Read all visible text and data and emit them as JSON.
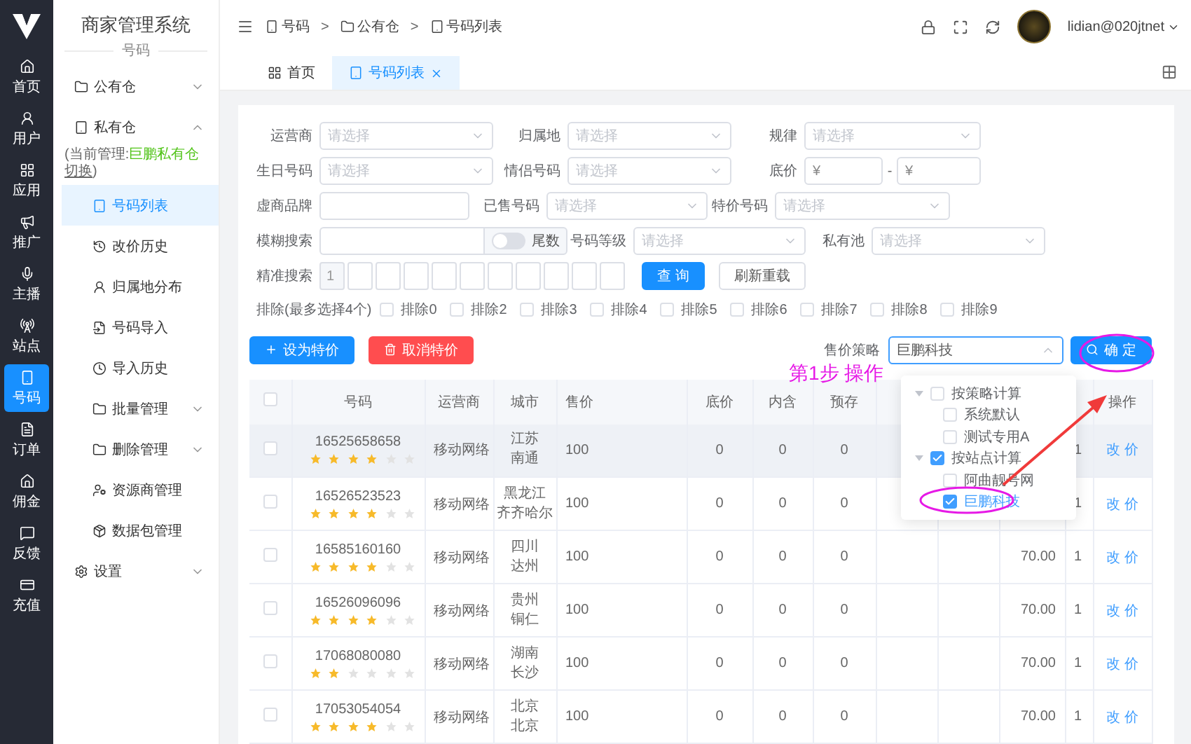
{
  "rail": {
    "items": [
      {
        "label": "首页",
        "selected": false
      },
      {
        "label": "用户",
        "selected": false
      },
      {
        "label": "应用",
        "selected": false
      },
      {
        "label": "推广",
        "selected": false
      },
      {
        "label": "主播",
        "selected": false
      },
      {
        "label": "站点",
        "selected": false
      },
      {
        "label": "号码",
        "selected": true
      },
      {
        "label": "订单",
        "selected": false
      },
      {
        "label": "佣金",
        "selected": false
      },
      {
        "label": "反馈",
        "selected": false
      },
      {
        "label": "充值",
        "selected": false
      }
    ]
  },
  "sidebar": {
    "title": "商家管理系统",
    "subtitle": "号码",
    "items": [
      {
        "label": "公有仓",
        "expanded": false
      },
      {
        "label": "私有仓",
        "expanded": true,
        "note": {
          "prefix": "(当前管理:",
          "highlight": "巨鹏私有仓",
          "link": "切换",
          "suffix": ")"
        },
        "children": [
          {
            "label": "号码列表",
            "kind": "link",
            "selected": true
          },
          {
            "label": "改价历史",
            "kind": "link",
            "selected": false
          },
          {
            "label": "归属地分布",
            "kind": "link",
            "selected": false
          },
          {
            "label": "号码导入",
            "kind": "link",
            "selected": false
          },
          {
            "label": "导入历史",
            "kind": "link",
            "selected": false
          },
          {
            "label": "批量管理",
            "kind": "group",
            "selected": false,
            "expanded": false
          },
          {
            "label": "删除管理",
            "kind": "group",
            "selected": false,
            "expanded": false
          },
          {
            "label": "资源商管理",
            "kind": "link",
            "selected": false
          },
          {
            "label": "数据包管理",
            "kind": "link",
            "selected": false
          }
        ]
      },
      {
        "label": "设置",
        "expanded": false
      }
    ]
  },
  "header": {
    "breadcrumb": [
      {
        "label": "号码",
        "separator": ">"
      },
      {
        "label": "公有仓",
        "separator": ">"
      },
      {
        "label": "号码列表"
      }
    ],
    "user": "lidian@020jtnet"
  },
  "tabs": [
    {
      "label": "首页",
      "selected": false,
      "closable": false
    },
    {
      "label": "号码列表",
      "selected": true,
      "closable": true
    }
  ],
  "filters": {
    "rows": [
      [
        {
          "label": "运营商",
          "kind": "select",
          "placeholder": "请选择"
        },
        {
          "label": "归属地",
          "kind": "select",
          "placeholder": "请选择"
        },
        {
          "label": "规律",
          "kind": "select",
          "placeholder": "请选择"
        }
      ],
      [
        {
          "label": "生日号码",
          "kind": "select",
          "placeholder": "请选择"
        },
        {
          "label": "情侣号码",
          "kind": "select",
          "placeholder": "请选择"
        },
        {
          "label": "底价",
          "kind": "range",
          "prefixes": [
            "¥",
            "¥"
          ],
          "separator": "-"
        }
      ],
      [
        {
          "label": "虚商品牌",
          "kind": "input"
        },
        {
          "label": "已售号码",
          "kind": "select",
          "placeholder": "请选择"
        },
        {
          "label": "特价号码",
          "kind": "select",
          "placeholder": "请选择"
        }
      ],
      [
        {
          "label": "模糊搜索",
          "kind": "fuzzy",
          "switch_label": "尾数",
          "on": false
        },
        {
          "label": "号码等级",
          "kind": "select",
          "placeholder": "请选择"
        },
        {
          "label": "私有池",
          "kind": "select",
          "placeholder": "请选择"
        }
      ],
      [
        {
          "label": "精准搜索",
          "kind": "digits",
          "first_digit": "1"
        }
      ]
    ],
    "actions": [
      {
        "label": "查 询",
        "kind": "primary"
      },
      {
        "label": "刷新重载",
        "kind": "default"
      }
    ],
    "exclude": {
      "label": "排除(最多选择4个)",
      "options": [
        {
          "label": "排除0",
          "checked": false
        },
        {
          "label": "排除2",
          "checked": false
        },
        {
          "label": "排除3",
          "checked": false
        },
        {
          "label": "排除4",
          "checked": false
        },
        {
          "label": "排除5",
          "checked": false
        },
        {
          "label": "排除6",
          "checked": false
        },
        {
          "label": "排除7",
          "checked": false
        },
        {
          "label": "排除8",
          "checked": false
        },
        {
          "label": "排除9",
          "checked": false
        }
      ]
    }
  },
  "toolbar": {
    "buttons": [
      {
        "label": "设为特价",
        "kind": "primary"
      },
      {
        "label": "取消特价",
        "kind": "danger"
      }
    ],
    "strategy": {
      "label": "售价策略",
      "value": "巨鹏科技",
      "open": true
    },
    "confirm": "确 定"
  },
  "strategy_tree": [
    {
      "label": "按策略计算",
      "checked": false,
      "expanded": true,
      "children": [
        {
          "label": "系统默认",
          "checked": false
        },
        {
          "label": "测试专用A",
          "checked": false
        }
      ]
    },
    {
      "label": "按站点计算",
      "checked": true,
      "expanded": true,
      "children": [
        {
          "label": "阿曲靓号网",
          "checked": false
        },
        {
          "label": "巨鹏科技",
          "checked": true
        }
      ]
    }
  ],
  "table": {
    "select_all": false,
    "columns": [
      {
        "label": "号码"
      },
      {
        "label": "运营商"
      },
      {
        "label": "城市"
      },
      {
        "label": "售价"
      },
      {
        "label": "底价"
      },
      {
        "label": "内含"
      },
      {
        "label": "预存"
      },
      {
        "label": "操作"
      }
    ],
    "rows": [
      {
        "checked": false,
        "hovered": true,
        "number": "16525658658",
        "stars": 4,
        "carrier": "移动网络",
        "province": "江苏",
        "city": "南通",
        "price": "100",
        "floor": "0",
        "included": "0",
        "prestore": "0",
        "column_12": "1",
        "action": "改 价"
      },
      {
        "checked": false,
        "hovered": false,
        "number": "16526523523",
        "stars": 4,
        "carrier": "移动网络",
        "province": "黑龙江",
        "city": "齐齐哈尔",
        "price": "100",
        "floor": "0",
        "included": "0",
        "prestore": "0",
        "column_12": "1",
        "action": "改 价"
      },
      {
        "checked": false,
        "hovered": false,
        "number": "16585160160",
        "stars": 4,
        "carrier": "移动网络",
        "province": "四川",
        "city": "达州",
        "price": "100",
        "floor": "0",
        "included": "0",
        "prestore": "0",
        "column_11": "70.00",
        "column_12": "1",
        "action": "改 价"
      },
      {
        "checked": false,
        "hovered": false,
        "number": "16526096096",
        "stars": 4,
        "carrier": "移动网络",
        "province": "贵州",
        "city": "铜仁",
        "price": "100",
        "floor": "0",
        "included": "0",
        "prestore": "0",
        "column_11": "70.00",
        "column_12": "1",
        "action": "改 价"
      },
      {
        "checked": false,
        "hovered": false,
        "number": "17068080080",
        "stars": 2,
        "carrier": "移动网络",
        "province": "湖南",
        "city": "长沙",
        "price": "100",
        "floor": "0",
        "included": "0",
        "prestore": "0",
        "column_11": "70.00",
        "column_12": "1",
        "action": "改 价"
      },
      {
        "checked": false,
        "hovered": false,
        "number": "17053054054",
        "stars": 4,
        "carrier": "移动网络",
        "province": "北京",
        "city": "北京",
        "price": "100",
        "floor": "0",
        "included": "0",
        "prestore": "0",
        "column_11": "70.00",
        "column_12": "1",
        "action": "改 价"
      }
    ]
  },
  "annotation": {
    "text": "第1步 操作"
  }
}
